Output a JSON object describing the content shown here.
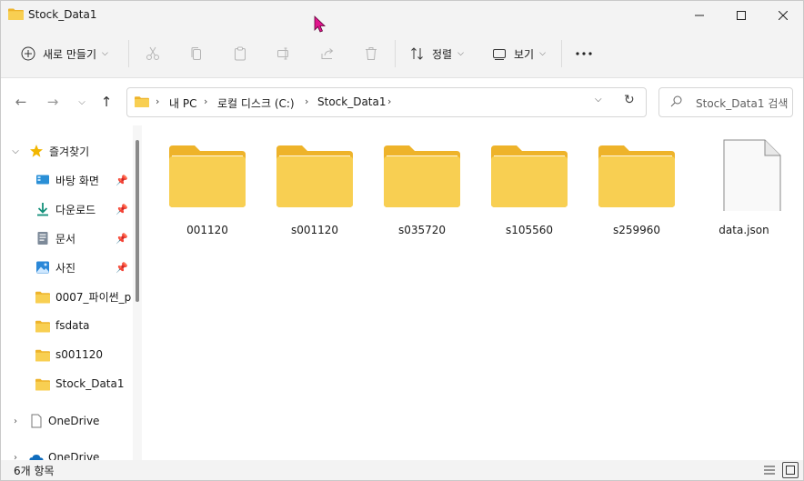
{
  "window": {
    "title": "Stock_Data1",
    "minimize_icon": "minimize-icon",
    "maximize_icon": "maximize-icon",
    "close_icon": "close-icon"
  },
  "toolbar": {
    "new_label": "새로 만들기",
    "sort_label": "정렬",
    "view_label": "보기",
    "icons": [
      "cut-icon",
      "copy-icon",
      "paste-icon",
      "rename-icon",
      "share-icon",
      "delete-icon"
    ],
    "more_icon": "more-icon"
  },
  "address": {
    "crumbs": [
      "내 PC",
      "로컬 디스크 (C:)",
      "Stock_Data1"
    ],
    "separator": "›"
  },
  "search": {
    "placeholder": "Stock_Data1 검색"
  },
  "sidebar": {
    "quick_access": "즐겨찾기",
    "items": [
      {
        "label": "바탕 화면",
        "icon": "desktop-icon",
        "pinned": true
      },
      {
        "label": "다운로드",
        "icon": "download-icon",
        "pinned": true
      },
      {
        "label": "문서",
        "icon": "documents-icon",
        "pinned": true
      },
      {
        "label": "사진",
        "icon": "pictures-icon",
        "pinned": true
      },
      {
        "label": "0007_파이썬_p",
        "icon": "folder-icon",
        "pinned": false
      },
      {
        "label": "fsdata",
        "icon": "folder-icon",
        "pinned": false
      },
      {
        "label": "s001120",
        "icon": "folder-icon",
        "pinned": false
      },
      {
        "label": "Stock_Data1",
        "icon": "folder-icon",
        "pinned": false
      }
    ],
    "onedrive_1": "OneDrive",
    "onedrive_2": "OneDrive"
  },
  "content": {
    "items": [
      {
        "name": "001120",
        "type": "folder"
      },
      {
        "name": "s001120",
        "type": "folder"
      },
      {
        "name": "s035720",
        "type": "folder"
      },
      {
        "name": "s105560",
        "type": "folder"
      },
      {
        "name": "s259960",
        "type": "folder"
      },
      {
        "name": "data.json",
        "type": "file"
      }
    ]
  },
  "status": {
    "count": "6개 항목"
  },
  "colors": {
    "folder_body": "#f8cf52",
    "folder_back": "#eeb32a",
    "accent": "#0067c0",
    "star": "#f2b600"
  }
}
